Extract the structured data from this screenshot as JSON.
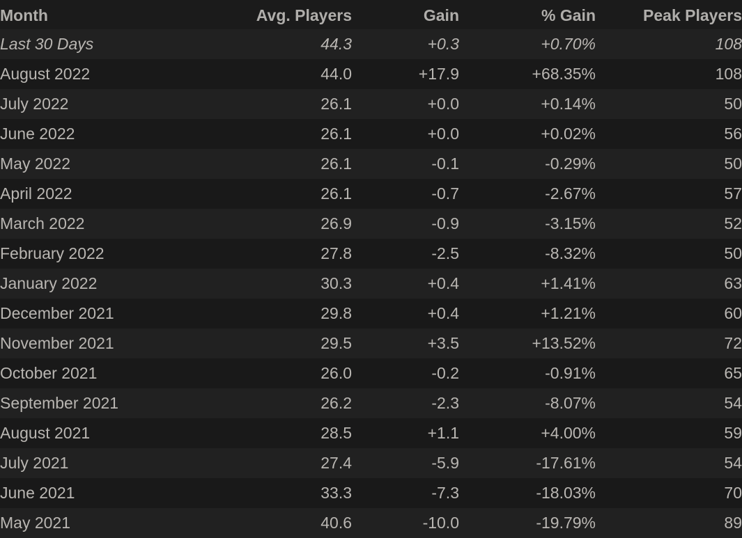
{
  "table": {
    "name": "monthly-player-statistics",
    "columns": [
      {
        "key": "month",
        "label": "Month",
        "align": "left"
      },
      {
        "key": "avg",
        "label": "Avg. Players",
        "align": "right"
      },
      {
        "key": "gain",
        "label": "Gain",
        "align": "right"
      },
      {
        "key": "pct",
        "label": "% Gain",
        "align": "right"
      },
      {
        "key": "peak",
        "label": "Peak Players",
        "align": "right"
      }
    ],
    "colors": {
      "background": "#1b1b1b",
      "row_odd": "#212121",
      "row_even": "#191919",
      "text": "#b9b6b2",
      "header_text": "#b0aeab",
      "gain_positive": "#3a9c23",
      "gain_negative": "#a63a1b"
    },
    "rows": [
      {
        "month": "Last 30 Days",
        "avg": "44.3",
        "gain": "+0.3",
        "pct": "+0.70%",
        "peak": "108",
        "direction": "up",
        "summary": true
      },
      {
        "month": "August 2022",
        "avg": "44.0",
        "gain": "+17.9",
        "pct": "+68.35%",
        "peak": "108",
        "direction": "up",
        "summary": false
      },
      {
        "month": "July 2022",
        "avg": "26.1",
        "gain": "+0.0",
        "pct": "+0.14%",
        "peak": "50",
        "direction": "up",
        "summary": false
      },
      {
        "month": "June 2022",
        "avg": "26.1",
        "gain": "+0.0",
        "pct": "+0.02%",
        "peak": "56",
        "direction": "up",
        "summary": false
      },
      {
        "month": "May 2022",
        "avg": "26.1",
        "gain": "-0.1",
        "pct": "-0.29%",
        "peak": "50",
        "direction": "down",
        "summary": false
      },
      {
        "month": "April 2022",
        "avg": "26.1",
        "gain": "-0.7",
        "pct": "-2.67%",
        "peak": "57",
        "direction": "down",
        "summary": false
      },
      {
        "month": "March 2022",
        "avg": "26.9",
        "gain": "-0.9",
        "pct": "-3.15%",
        "peak": "52",
        "direction": "down",
        "summary": false
      },
      {
        "month": "February 2022",
        "avg": "27.8",
        "gain": "-2.5",
        "pct": "-8.32%",
        "peak": "50",
        "direction": "down",
        "summary": false
      },
      {
        "month": "January 2022",
        "avg": "30.3",
        "gain": "+0.4",
        "pct": "+1.41%",
        "peak": "63",
        "direction": "up",
        "summary": false
      },
      {
        "month": "December 2021",
        "avg": "29.8",
        "gain": "+0.4",
        "pct": "+1.21%",
        "peak": "60",
        "direction": "up",
        "summary": false
      },
      {
        "month": "November 2021",
        "avg": "29.5",
        "gain": "+3.5",
        "pct": "+13.52%",
        "peak": "72",
        "direction": "up",
        "summary": false
      },
      {
        "month": "October 2021",
        "avg": "26.0",
        "gain": "-0.2",
        "pct": "-0.91%",
        "peak": "65",
        "direction": "down",
        "summary": false
      },
      {
        "month": "September 2021",
        "avg": "26.2",
        "gain": "-2.3",
        "pct": "-8.07%",
        "peak": "54",
        "direction": "down",
        "summary": false
      },
      {
        "month": "August 2021",
        "avg": "28.5",
        "gain": "+1.1",
        "pct": "+4.00%",
        "peak": "59",
        "direction": "up",
        "summary": false
      },
      {
        "month": "July 2021",
        "avg": "27.4",
        "gain": "-5.9",
        "pct": "-17.61%",
        "peak": "54",
        "direction": "down",
        "summary": false
      },
      {
        "month": "June 2021",
        "avg": "33.3",
        "gain": "-7.3",
        "pct": "-18.03%",
        "peak": "70",
        "direction": "down",
        "summary": false
      },
      {
        "month": "May 2021",
        "avg": "40.6",
        "gain": "-10.0",
        "pct": "-19.79%",
        "peak": "89",
        "direction": "down",
        "summary": false
      }
    ]
  }
}
